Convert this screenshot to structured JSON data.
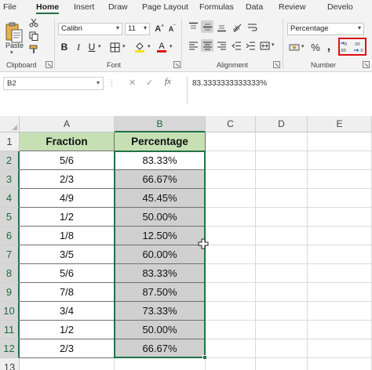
{
  "tabs": [
    {
      "label": "File",
      "active": false
    },
    {
      "label": "Home",
      "active": true
    },
    {
      "label": "Insert",
      "active": false
    },
    {
      "label": "Draw",
      "active": false
    },
    {
      "label": "Page Layout",
      "active": false
    },
    {
      "label": "Formulas",
      "active": false
    },
    {
      "label": "Data",
      "active": false
    },
    {
      "label": "Review",
      "active": false
    },
    {
      "label": "Develo",
      "active": false
    }
  ],
  "ribbon": {
    "clipboard": {
      "paste_label": "Paste",
      "group_label": "Clipboard"
    },
    "font": {
      "font_name": "Calibri",
      "font_size": "11",
      "group_label": "Font"
    },
    "alignment": {
      "group_label": "Alignment"
    },
    "number": {
      "format": "Percentage",
      "group_label": "Number"
    }
  },
  "formula_bar": {
    "name_box": "B2",
    "formula": "83.3333333333333%"
  },
  "grid": {
    "columns": [
      "A",
      "B",
      "C",
      "D",
      "E"
    ],
    "rows": [
      "1",
      "2",
      "3",
      "4",
      "5",
      "6",
      "7",
      "8",
      "9",
      "10",
      "11",
      "12",
      "13"
    ],
    "header": {
      "fraction": "Fraction",
      "percentage": "Percentage"
    },
    "data": [
      {
        "fraction": "5/6",
        "percentage": "83.33%"
      },
      {
        "fraction": "2/3",
        "percentage": "66.67%"
      },
      {
        "fraction": "4/9",
        "percentage": "45.45%"
      },
      {
        "fraction": "1/2",
        "percentage": "50.00%"
      },
      {
        "fraction": "1/8",
        "percentage": "12.50%"
      },
      {
        "fraction": "3/5",
        "percentage": "60.00%"
      },
      {
        "fraction": "5/6",
        "percentage": "83.33%"
      },
      {
        "fraction": "7/8",
        "percentage": "87.50%"
      },
      {
        "fraction": "3/4",
        "percentage": "73.33%"
      },
      {
        "fraction": "1/2",
        "percentage": "50.00%"
      },
      {
        "fraction": "2/3",
        "percentage": "66.67%"
      }
    ]
  },
  "colors": {
    "accent": "#217346",
    "header_fill": "#c6e0b4",
    "highlight": "#e01010"
  }
}
